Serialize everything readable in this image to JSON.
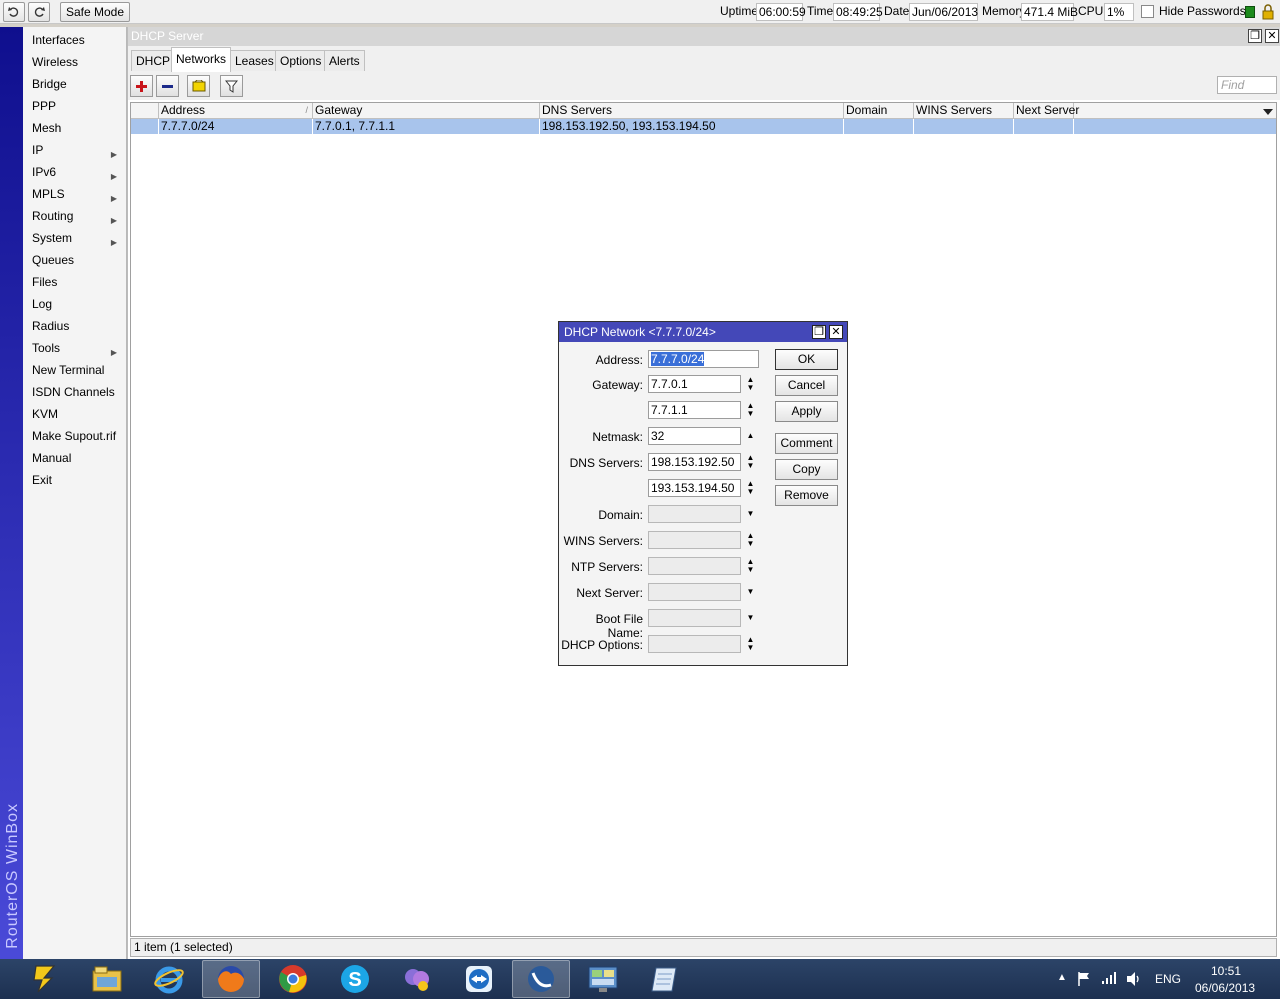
{
  "topbar": {
    "safe_mode": "Safe Mode",
    "uptime_label": "Uptime:",
    "uptime": "06:00:59",
    "time_label": "Time:",
    "time": "08:49:25",
    "date_label": "Date:",
    "date": "Jun/06/2013",
    "memory_label": "Memory:",
    "memory": "471.4 MiB",
    "cpu_label": "CPU:",
    "cpu": "1%",
    "hide_passwords": "Hide Passwords",
    "hide_passwords_checked": false
  },
  "brand": "RouterOS WinBox",
  "menu": [
    {
      "label": "Interfaces",
      "submenu": false
    },
    {
      "label": "Wireless",
      "submenu": false
    },
    {
      "label": "Bridge",
      "submenu": false
    },
    {
      "label": "PPP",
      "submenu": false
    },
    {
      "label": "Mesh",
      "submenu": false
    },
    {
      "label": "IP",
      "submenu": true
    },
    {
      "label": "IPv6",
      "submenu": true
    },
    {
      "label": "MPLS",
      "submenu": true
    },
    {
      "label": "Routing",
      "submenu": true
    },
    {
      "label": "System",
      "submenu": true
    },
    {
      "label": "Queues",
      "submenu": false
    },
    {
      "label": "Files",
      "submenu": false
    },
    {
      "label": "Log",
      "submenu": false
    },
    {
      "label": "Radius",
      "submenu": false
    },
    {
      "label": "Tools",
      "submenu": true
    },
    {
      "label": "New Terminal",
      "submenu": false
    },
    {
      "label": "ISDN Channels",
      "submenu": false
    },
    {
      "label": "KVM",
      "submenu": false
    },
    {
      "label": "Make Supout.rif",
      "submenu": false
    },
    {
      "label": "Manual",
      "submenu": false
    },
    {
      "label": "Exit",
      "submenu": false
    }
  ],
  "window": {
    "title": "DHCP Server",
    "tabs": [
      "DHCP",
      "Networks",
      "Leases",
      "Options",
      "Alerts"
    ],
    "active_tab": "Networks",
    "find_placeholder": "Find",
    "columns": [
      "Address",
      "Gateway",
      "DNS Servers",
      "Domain",
      "WINS Servers",
      "Next Server"
    ],
    "rows": [
      {
        "address": "7.7.7.0/24",
        "gateway": "7.7.0.1, 7.7.1.1",
        "dns": "198.153.192.50, 193.153.194.50",
        "domain": "",
        "wins": "",
        "next_server": ""
      }
    ],
    "status": "1 item (1 selected)"
  },
  "dialog": {
    "title": "DHCP Network <7.7.7.0/24>",
    "labels": {
      "address": "Address:",
      "gateway": "Gateway:",
      "netmask": "Netmask:",
      "dns": "DNS Servers:",
      "domain": "Domain:",
      "wins": "WINS Servers:",
      "ntp": "NTP Servers:",
      "next_server": "Next Server:",
      "boot_file": "Boot File Name:",
      "dhcp_options": "DHCP Options:"
    },
    "values": {
      "address": "7.7.7.0/24",
      "gateway_1": "7.7.0.1",
      "gateway_2": "7.7.1.1",
      "netmask": "32",
      "dns_1": "198.153.192.50",
      "dns_2": "193.153.194.50",
      "domain": "",
      "wins": "",
      "ntp": "",
      "next_server": "",
      "boot_file": "",
      "dhcp_options": ""
    },
    "buttons": {
      "ok": "OK",
      "cancel": "Cancel",
      "apply": "Apply",
      "comment": "Comment",
      "copy": "Copy",
      "remove": "Remove"
    }
  },
  "taskbar": {
    "apps": [
      "winamp-icon",
      "file-explorer-icon",
      "internet-explorer-icon",
      "firefox-icon",
      "chrome-icon",
      "skype-icon",
      "messenger-icon",
      "teamviewer-icon",
      "winbox-icon",
      "control-panel-icon",
      "notepad-icon"
    ],
    "language": "ENG",
    "clock_time": "10:51",
    "clock_date": "06/06/2013"
  }
}
